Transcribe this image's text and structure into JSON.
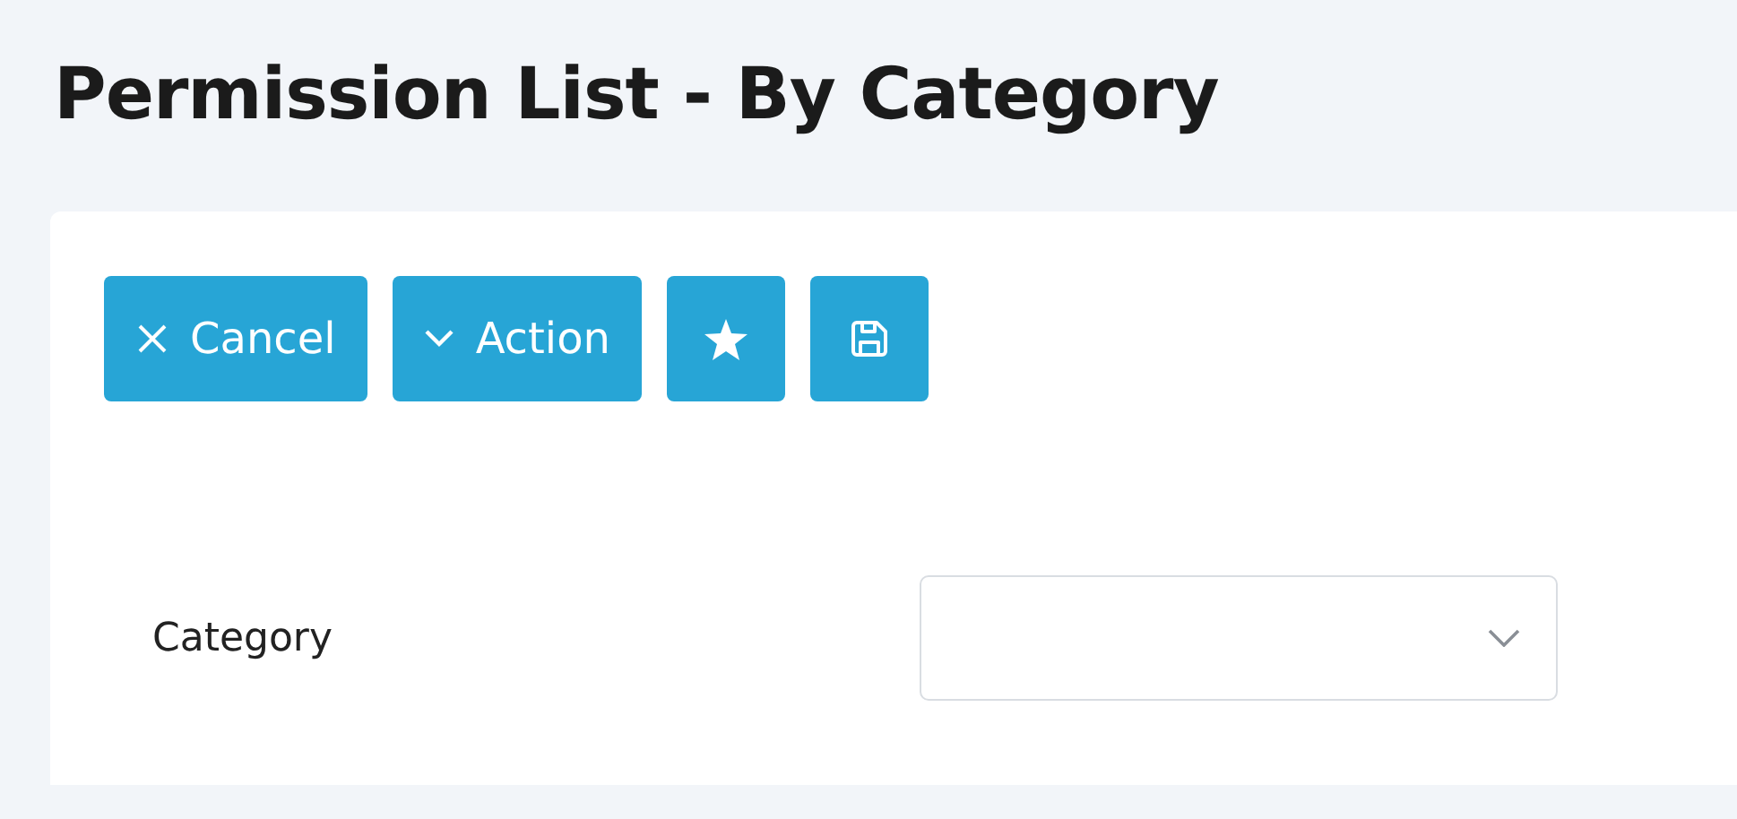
{
  "page": {
    "title": "Permission List - By Category"
  },
  "toolbar": [
    {
      "kind": "cancel",
      "label": "Cancel"
    },
    {
      "kind": "action",
      "label": "Action"
    },
    {
      "kind": "favorite"
    },
    {
      "kind": "save"
    }
  ],
  "fields": [
    {
      "kind": "select",
      "label": "Category"
    }
  ]
}
